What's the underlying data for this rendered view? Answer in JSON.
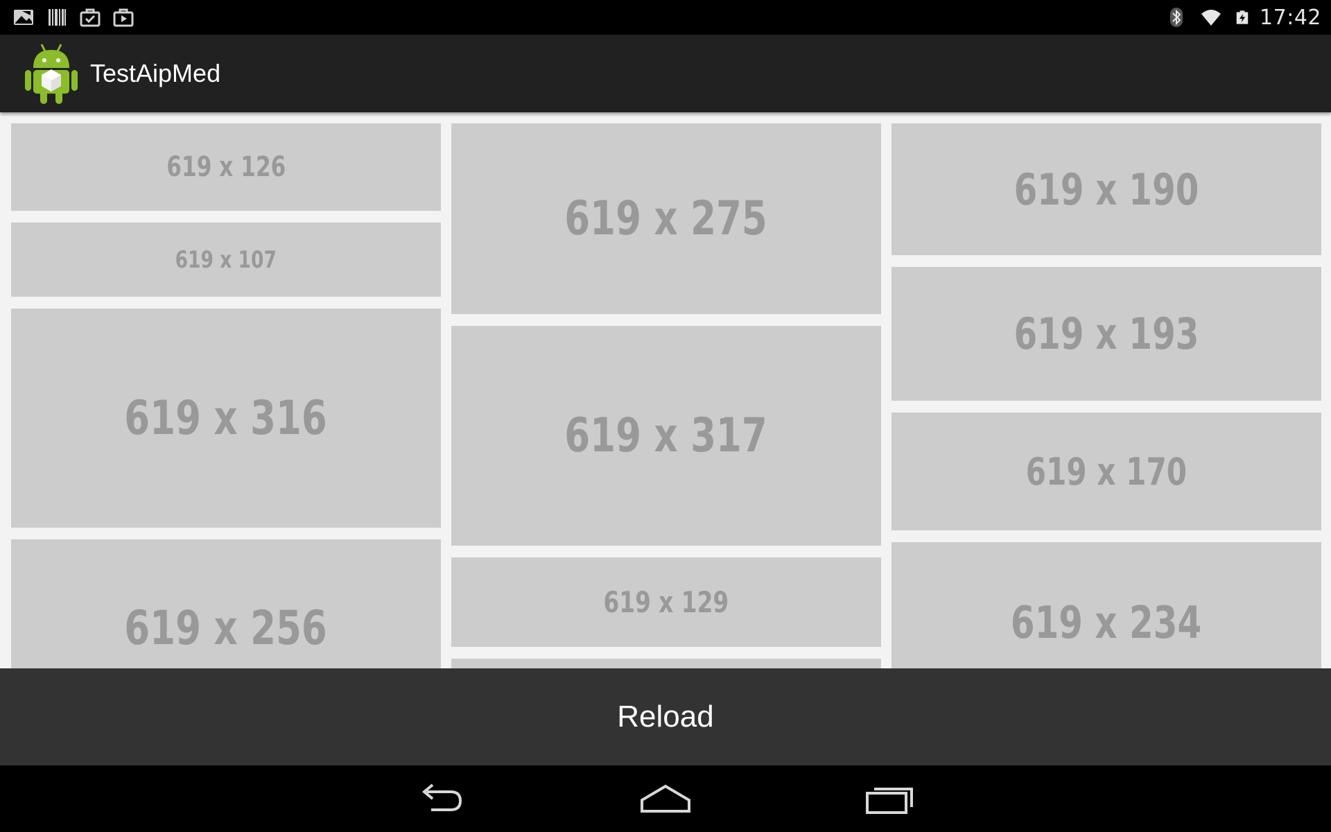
{
  "status_bar": {
    "left_icons": [
      "gallery-icon",
      "barcode-icon",
      "briefcase-check-icon",
      "briefcase-play-icon"
    ],
    "right_icons": [
      "bluetooth-icon",
      "wifi-icon",
      "battery-charging-icon"
    ],
    "time": "17:42"
  },
  "action_bar": {
    "app_icon": "android-robot-icon",
    "title": "TestAipMed"
  },
  "grid": {
    "tile_color": "#cccccc",
    "text_color": "#999999",
    "columns": [
      {
        "tiles": [
          {
            "label": "619 x 126"
          },
          {
            "label": "619 x 107"
          },
          {
            "label": "619 x 316"
          },
          {
            "label": "619 x 256"
          }
        ]
      },
      {
        "tiles": [
          {
            "label": "619 x 275"
          },
          {
            "label": "619 x 317"
          },
          {
            "label": "619 x 129"
          },
          {
            "label": ""
          }
        ]
      },
      {
        "tiles": [
          {
            "label": "619 x 190"
          },
          {
            "label": "619 x 193"
          },
          {
            "label": "619 x 170"
          },
          {
            "label": "619 x 234"
          }
        ]
      }
    ]
  },
  "reload_button": {
    "label": "Reload"
  },
  "nav_bar": {
    "buttons": [
      "back-icon",
      "home-icon",
      "recents-icon"
    ]
  }
}
